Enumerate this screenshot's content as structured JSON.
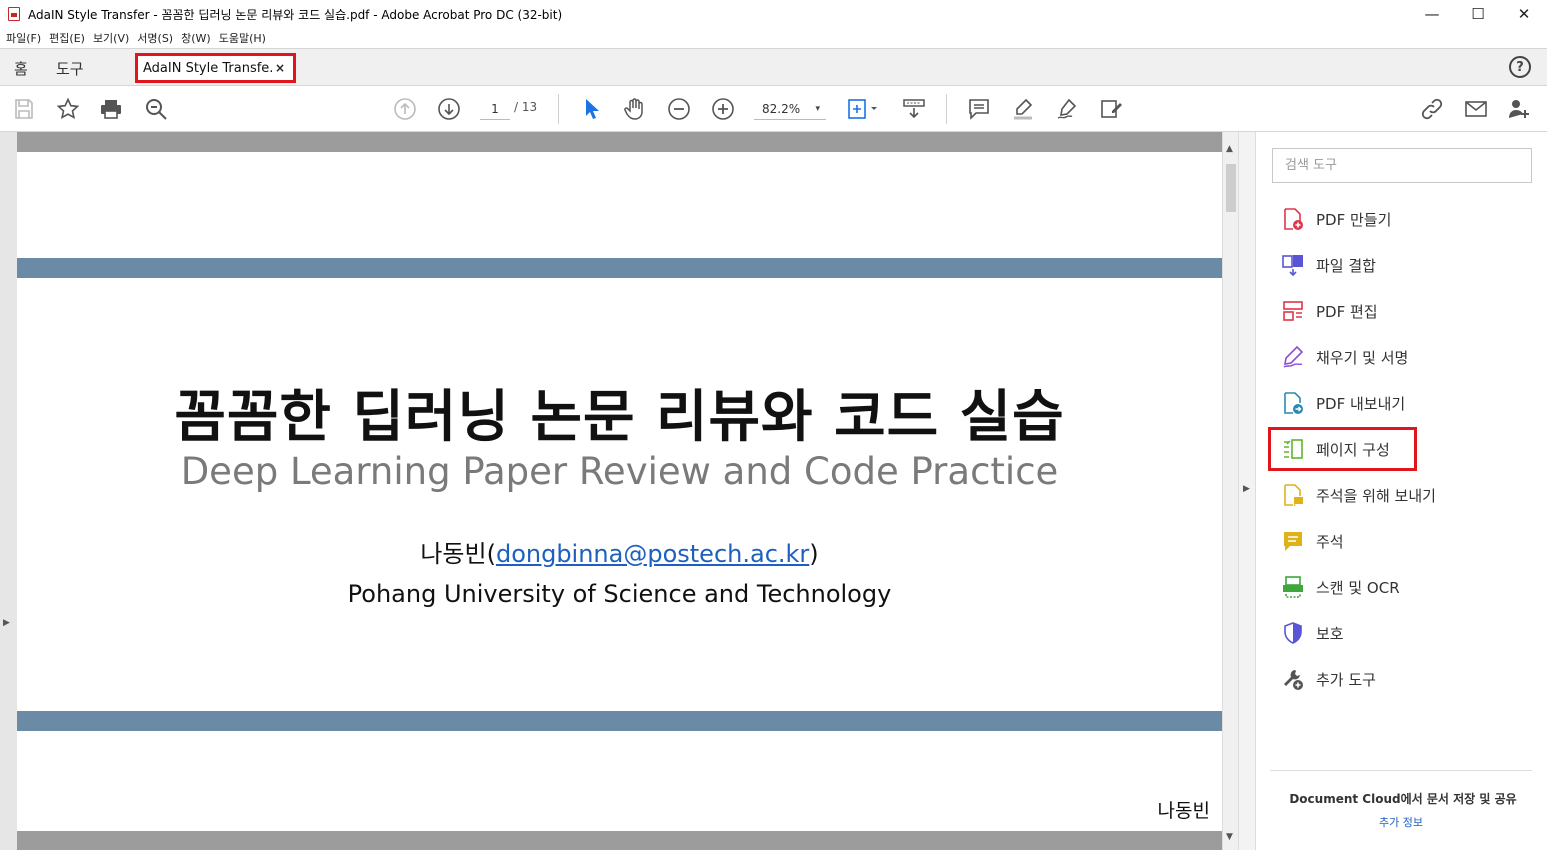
{
  "window": {
    "title": "AdaIN Style Transfer - 꼼꼼한 딥러닝 논문 리뷰와 코드 실습.pdf - Adobe Acrobat Pro DC (32-bit)",
    "minimize": "—",
    "maximize": "☐",
    "close": "✕"
  },
  "menu": [
    "파일(F)",
    "편집(E)",
    "보기(V)",
    "서명(S)",
    "창(W)",
    "도움말(H)"
  ],
  "tabs": {
    "home": "홈",
    "tools": "도구",
    "document": "AdaIN Style Transfe...",
    "close": "×",
    "help": "?"
  },
  "toolbar": {
    "page_current": "1",
    "page_total": "/ 13",
    "zoom": "82.2%",
    "zoom_chevron": "▾"
  },
  "slide": {
    "title": "꼼꼼한 딥러닝 논문 리뷰와 코드 실습",
    "subtitle": "Deep Learning Paper Review and Code Practice",
    "author_name": "나동빈(",
    "author_email": "dongbinna@postech.ac.kr",
    "author_close": ")",
    "affiliation": "Pohang University of Science and Technology",
    "footer": "나동빈"
  },
  "panel": {
    "search_placeholder": "검색 도구",
    "tools": [
      {
        "label": "PDF 만들기",
        "icon": "create-pdf-icon",
        "color": "#e0364a"
      },
      {
        "label": "파일 결합",
        "icon": "combine-files-icon",
        "color": "#5a55d6"
      },
      {
        "label": "PDF 편집",
        "icon": "edit-pdf-icon",
        "color": "#e0364a"
      },
      {
        "label": "채우기 및 서명",
        "icon": "fill-sign-icon",
        "color": "#8a4fd6"
      },
      {
        "label": "PDF 내보내기",
        "icon": "export-pdf-icon",
        "color": "#2a8ab0"
      },
      {
        "label": "페이지 구성",
        "icon": "organize-pages-icon",
        "color": "#5fb52e"
      },
      {
        "label": "주석을 위해 보내기",
        "icon": "send-comments-icon",
        "color": "#e0b21a"
      },
      {
        "label": "주석",
        "icon": "comment-icon",
        "color": "#e0b21a"
      },
      {
        "label": "스캔 및 OCR",
        "icon": "scan-ocr-icon",
        "color": "#3da63d"
      },
      {
        "label": "보호",
        "icon": "protect-icon",
        "color": "#5a55d6"
      },
      {
        "label": "추가 도구",
        "icon": "more-tools-icon",
        "color": "#555555"
      }
    ],
    "cloud_text": "Document Cloud에서 문서 저장 및 공유",
    "cloud_link": "추가 정보"
  }
}
